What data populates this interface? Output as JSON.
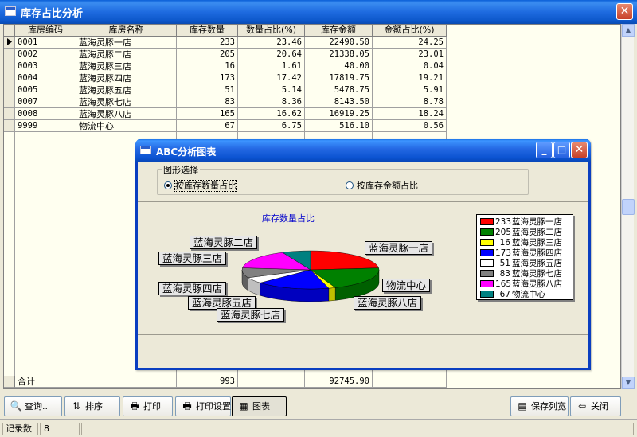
{
  "window": {
    "title": "库存占比分析",
    "close": "✕"
  },
  "table": {
    "headers": [
      "库房编码",
      "库房名称",
      "库存数量",
      "数量占比(%)",
      "库存金额",
      "金额占比(%)"
    ],
    "rows": [
      {
        "code": "0001",
        "name": "蓝海灵豚一店",
        "qty": "233",
        "qty_pct": "23.46",
        "amount": "22490.50",
        "amount_pct": "24.25"
      },
      {
        "code": "0002",
        "name": "蓝海灵豚二店",
        "qty": "205",
        "qty_pct": "20.64",
        "amount": "21338.05",
        "amount_pct": "23.01"
      },
      {
        "code": "0003",
        "name": "蓝海灵豚三店",
        "qty": "16",
        "qty_pct": "1.61",
        "amount": "40.00",
        "amount_pct": "0.04"
      },
      {
        "code": "0004",
        "name": "蓝海灵豚四店",
        "qty": "173",
        "qty_pct": "17.42",
        "amount": "17819.75",
        "amount_pct": "19.21"
      },
      {
        "code": "0005",
        "name": "蓝海灵豚五店",
        "qty": "51",
        "qty_pct": "5.14",
        "amount": "5478.75",
        "amount_pct": "5.91"
      },
      {
        "code": "0007",
        "name": "蓝海灵豚七店",
        "qty": "83",
        "qty_pct": "8.36",
        "amount": "8143.50",
        "amount_pct": "8.78"
      },
      {
        "code": "0008",
        "name": "蓝海灵豚八店",
        "qty": "165",
        "qty_pct": "16.62",
        "amount": "16919.25",
        "amount_pct": "18.24"
      },
      {
        "code": "9999",
        "name": "物流中心",
        "qty": "67",
        "qty_pct": "6.75",
        "amount": "516.10",
        "amount_pct": "0.56"
      }
    ],
    "total": {
      "label": "合计",
      "qty": "993",
      "amount": "92745.90"
    }
  },
  "toolbar": {
    "query": "查询..",
    "sort": "排序",
    "print": "打印",
    "print_setup": "打印设置",
    "chart": "图表",
    "save_width": "保存列宽",
    "close": "关闭"
  },
  "status": {
    "label": "记录数",
    "count": "8"
  },
  "dialog": {
    "title": "ABC分析图表",
    "group_title": "图形选择",
    "radio_qty": "按库存数量占比",
    "radio_amount": "按库存金额占比",
    "selected": "qty",
    "chart_title": "库存数量占比"
  },
  "chart_data": {
    "type": "pie",
    "title": "库存数量占比",
    "categories": [
      "蓝海灵豚一店",
      "蓝海灵豚二店",
      "蓝海灵豚三店",
      "蓝海灵豚四店",
      "蓝海灵豚五店",
      "蓝海灵豚七店",
      "蓝海灵豚八店",
      "物流中心"
    ],
    "values": [
      233,
      205,
      16,
      173,
      51,
      83,
      165,
      67
    ],
    "colors": [
      "#FF0000",
      "#008000",
      "#FFFF00",
      "#0000FF",
      "#FFFFFF",
      "#808080",
      "#FF00FF",
      "#008080"
    ],
    "legend": "right"
  }
}
